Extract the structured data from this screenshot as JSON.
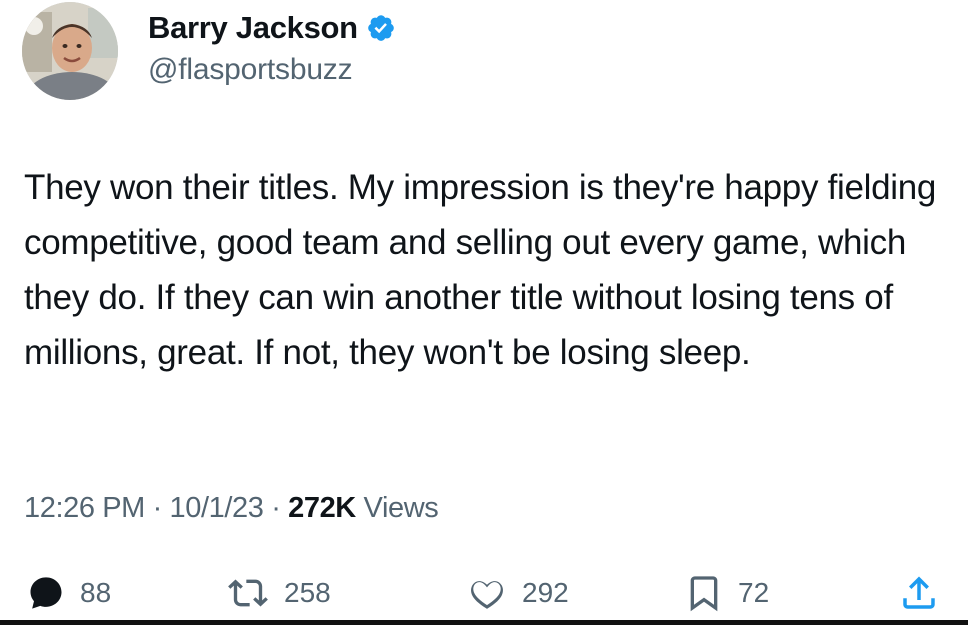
{
  "author": {
    "name": "Barry Jackson",
    "handle": "@flasportsbuzz",
    "verified": true,
    "verified_color": "#1d9bf0"
  },
  "tweet": {
    "text": "They won their titles. My impression is they're happy fielding competitive, good team and selling out every game, which they do. If they can win another title without losing tens of millions, great. If not, they won't be losing sleep.",
    "time": "12:26 PM",
    "separator": "·",
    "date": "10/1/23",
    "views_count": "272K",
    "views_label": "Views"
  },
  "actions": {
    "replies": "88",
    "retweets": "258",
    "likes": "292",
    "bookmarks": "72"
  },
  "icons": {
    "reply": "reply-icon",
    "retweet": "retweet-icon",
    "like": "heart-icon",
    "bookmark": "bookmark-icon",
    "share": "share-icon",
    "verified": "verified-badge-icon"
  }
}
